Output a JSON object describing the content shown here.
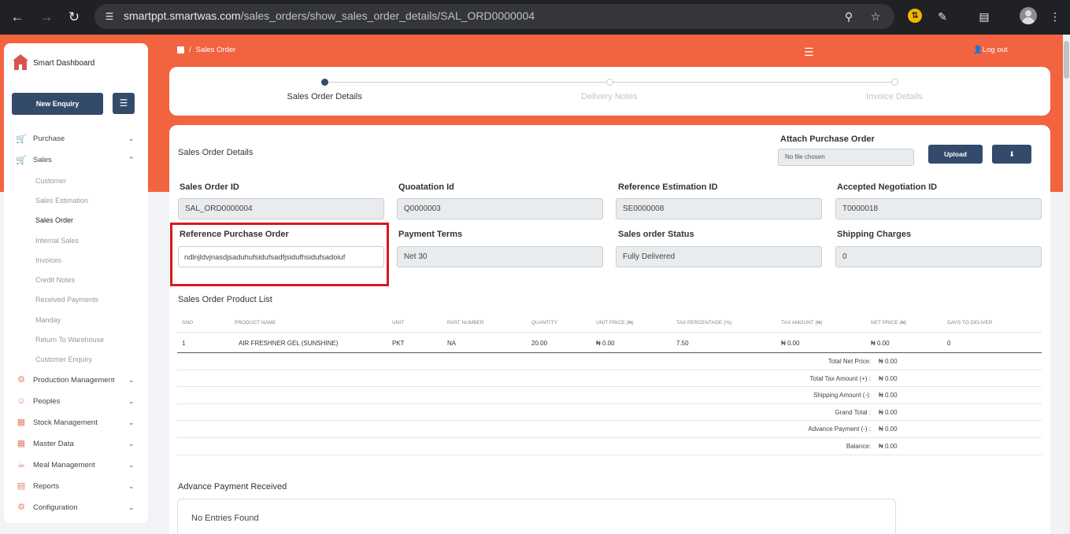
{
  "browser": {
    "url_host": "smartppt.smartwas.com",
    "url_path": "/sales_orders/show_sales_order_details/SAL_ORD0000004"
  },
  "sidebar": {
    "brand": "Smart Dashboard",
    "new_enquiry": "New Enquiry",
    "menu": [
      {
        "label": "Purchase",
        "icon": "cart-icon",
        "chevron": "down"
      },
      {
        "label": "Sales",
        "icon": "sales-icon",
        "chevron": "up"
      }
    ],
    "sales_sub": [
      "Customer",
      "Sales Estimation",
      "Sales Order",
      "Internal Sales",
      "Invoices",
      "Credit Notes",
      "Received Payments",
      "Manday",
      "Return To Warehouse",
      "Customer Enquiry"
    ],
    "sales_sub_active": "Sales Order",
    "menu_after": [
      {
        "label": "Production Management",
        "icon": "production-icon"
      },
      {
        "label": "Peoples",
        "icon": "people-icon"
      },
      {
        "label": "Stock Management",
        "icon": "stock-icon"
      },
      {
        "label": "Master Data",
        "icon": "master-data-icon"
      },
      {
        "label": "Meal Management",
        "icon": "meal-icon"
      },
      {
        "label": "Reports",
        "icon": "reports-icon"
      },
      {
        "label": "Configuration",
        "icon": "config-icon"
      }
    ]
  },
  "header": {
    "breadcrumb": "Sales Order",
    "logout": "Log out"
  },
  "stepper": [
    {
      "label": "Sales Order Details",
      "active": true
    },
    {
      "label": "Delivery Notes",
      "active": false
    },
    {
      "label": "Invoice Details",
      "active": false
    }
  ],
  "details": {
    "section_title": "Sales Order Details",
    "attach_label": "Attach Purchase Order",
    "file_placeholder": "No file chosen",
    "upload": "Upload",
    "fields": {
      "sales_order_id": {
        "label": "Sales Order ID",
        "value": "SAL_ORD0000004"
      },
      "quotation_id": {
        "label": "Quoatation Id",
        "value": "Q0000003"
      },
      "ref_estimation_id": {
        "label": "Reference Estimation ID",
        "value": "SE0000008"
      },
      "accepted_negotiation_id": {
        "label": "Accepted Negotiation ID",
        "value": "T0000018"
      },
      "ref_purchase_order": {
        "label": "Reference Purchase Order",
        "value": "ndlnjldvjnasdjsaduhufsidufsadfjsidufhsidufsadoiuf"
      },
      "payment_terms": {
        "label": "Payment Terms",
        "value": "Net 30"
      },
      "sales_order_status": {
        "label": "Sales order Status",
        "value": "Fully Delivered"
      },
      "shipping_charges": {
        "label": "Shipping Charges",
        "value": "0"
      }
    }
  },
  "products": {
    "title": "Sales Order Product List",
    "columns": [
      "SNO",
      "PRODUCT NAME",
      "UNIT",
      "PART NUMBER",
      "QUANTITY",
      "UNIT PRICE (₦)",
      "TAX PERCENTAGE (%)",
      "TAX AMOUNT (₦)",
      "NET PRICE (₦)",
      "DAYS TO DELIVER"
    ],
    "rows": [
      [
        "1",
        "AIR FRESHNER GEL (SUNSHINE)",
        "PKT",
        "NA",
        "20.00",
        "₦ 0.00",
        "7.50",
        "₦ 0.00",
        "₦ 0.00",
        "0"
      ]
    ],
    "summary": [
      {
        "label": "Total Net Price:",
        "value": "₦ 0.00"
      },
      {
        "label": "Total Tax Amount (+) :",
        "value": "₦ 0.00"
      },
      {
        "label": "Shipping Amount (-):",
        "value": "₦ 0.00"
      },
      {
        "label": "Grand Total :",
        "value": "₦ 0.00"
      },
      {
        "label": "Advance Payment (-) :",
        "value": "₦ 0.00"
      },
      {
        "label": "Balance:",
        "value": "₦ 0.00"
      }
    ]
  },
  "advance": {
    "title": "Advance Payment Received",
    "empty": "No Entries Found"
  },
  "colors": {
    "brand_orange": "#f26340",
    "navy_button": "#344a6b",
    "highlight_red": "#d9181d"
  }
}
